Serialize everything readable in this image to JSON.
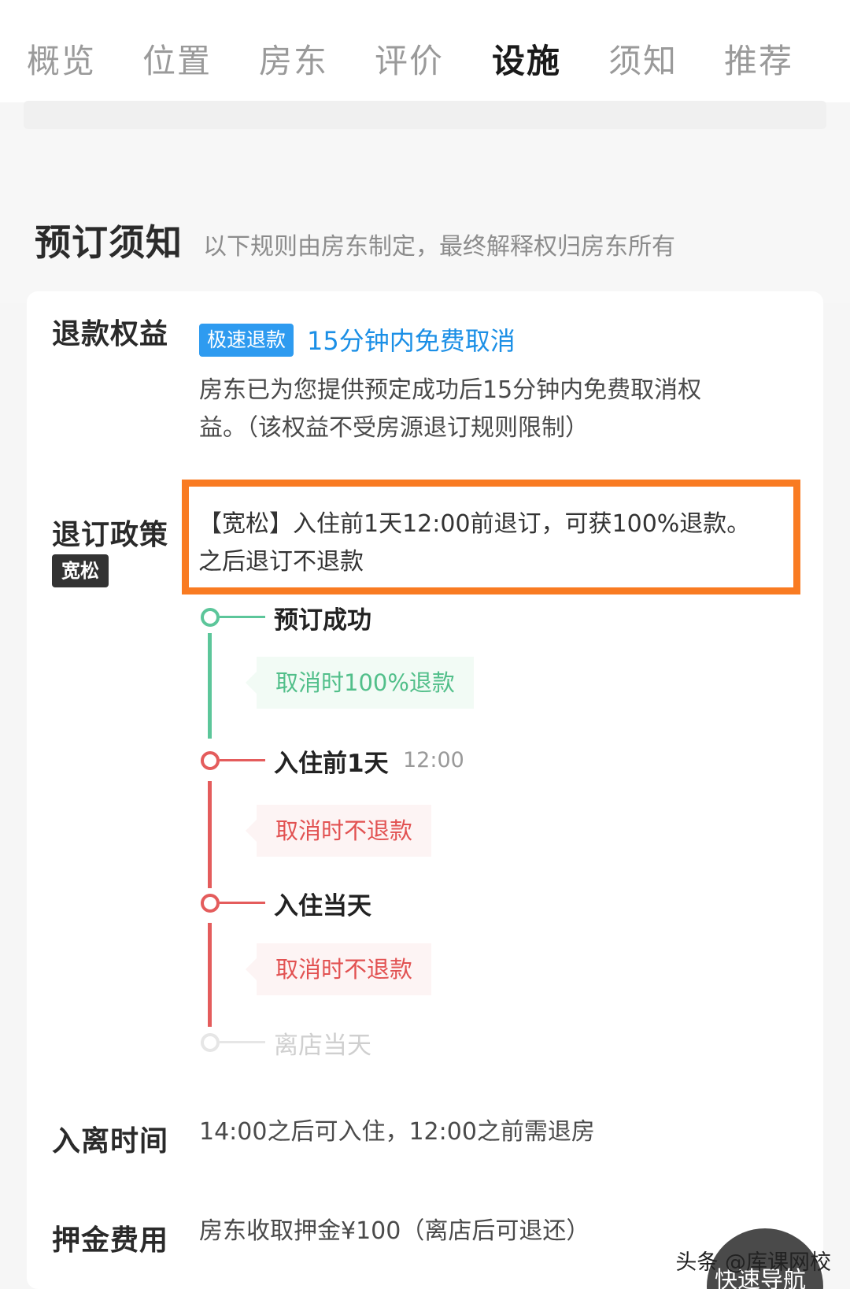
{
  "tabs": [
    {
      "label": "概览",
      "active": false
    },
    {
      "label": "位置",
      "active": false
    },
    {
      "label": "房东",
      "active": false
    },
    {
      "label": "评价",
      "active": false
    },
    {
      "label": "设施",
      "active": true
    },
    {
      "label": "须知",
      "active": false
    },
    {
      "label": "推荐",
      "active": false
    }
  ],
  "section": {
    "title": "预订须知",
    "subtitle": "以下规则由房东制定，最终解释权归房东所有"
  },
  "refund_rights": {
    "label": "退款权益",
    "badge": "极速退款",
    "link_text": "15分钟内免费取消",
    "description_line1": "房东已为您提供预定成功后15分钟内免费取消权",
    "description_line2": "益。（该权益不受房源退订规则限制）"
  },
  "cancel_policy": {
    "label": "退订政策",
    "tag": "宽松",
    "text_line1": "【宽松】入住前1天12:00前退订，可获100%退款。",
    "text_line2": "之后退订不退款"
  },
  "timeline": [
    {
      "title": "预订成功",
      "time": "",
      "note": "取消时100%退款",
      "status": "green"
    },
    {
      "title": "入住前1天",
      "time": "12:00",
      "note": "取消时不退款",
      "status": "red"
    },
    {
      "title": "入住当天",
      "time": "",
      "note": "取消时不退款",
      "status": "red"
    },
    {
      "title": "离店当天",
      "time": "",
      "note": "",
      "status": "faded"
    }
  ],
  "checkin": {
    "label": "入离时间",
    "value": "14:00之后可入住，12:00之前需退房"
  },
  "deposit": {
    "label": "押金费用",
    "value": "房东收取押金¥100（离店后可退还）"
  },
  "watermark": "头条 @库课网校",
  "nav_button": "快速导航",
  "colors": {
    "accent_blue": "#1b8fe6",
    "badge_blue": "#2e9bf0",
    "highlight_orange": "#f97b22",
    "timeline_green": "#52bf8a",
    "timeline_red": "#e25252"
  }
}
